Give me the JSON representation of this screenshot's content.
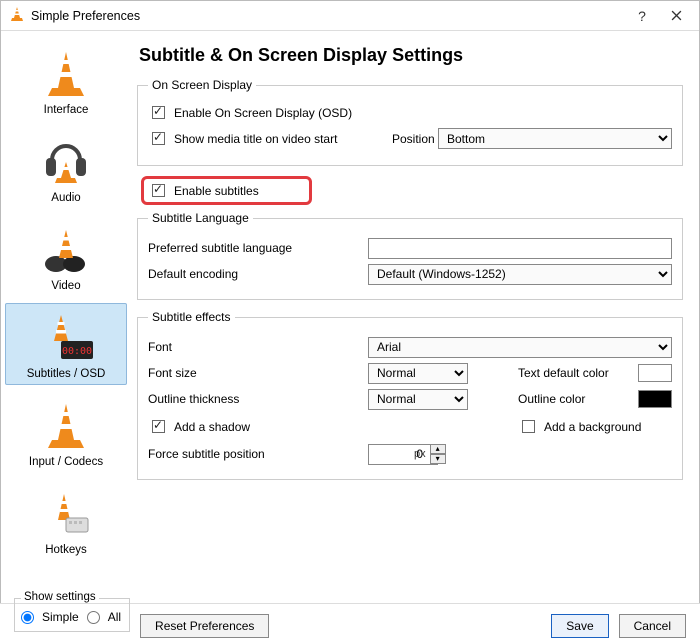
{
  "window_title": "Simple Preferences",
  "sidebar": {
    "items": [
      {
        "label": "Interface"
      },
      {
        "label": "Audio"
      },
      {
        "label": "Video"
      },
      {
        "label": "Subtitles / OSD"
      },
      {
        "label": "Input / Codecs"
      },
      {
        "label": "Hotkeys"
      }
    ],
    "selected_index": 3
  },
  "page_heading": "Subtitle & On Screen Display Settings",
  "osd_group_title": "On Screen Display",
  "osd_enable_label": "Enable On Screen Display (OSD)",
  "osd_enable_checked": true,
  "show_media_title_label": "Show media title on video start",
  "show_media_title_checked": true,
  "position_label": "Position",
  "position_value": "Bottom",
  "enable_subtitles_label": "Enable subtitles",
  "enable_subtitles_checked": true,
  "lang_group_title": "Subtitle Language",
  "preferred_lang_label": "Preferred subtitle language",
  "preferred_lang_value": "",
  "encoding_label": "Default encoding",
  "encoding_value": "Default (Windows-1252)",
  "fx_group_title": "Subtitle effects",
  "font_label": "Font",
  "font_value": "Arial",
  "font_size_label": "Font size",
  "font_size_value": "Normal",
  "text_color_label": "Text default color",
  "text_color_value": "#ffffff",
  "outline_thickness_label": "Outline thickness",
  "outline_thickness_value": "Normal",
  "outline_color_label": "Outline color",
  "outline_color_value": "#000000",
  "add_shadow_label": "Add a shadow",
  "add_shadow_checked": true,
  "add_background_label": "Add a background",
  "add_background_checked": false,
  "force_position_label": "Force subtitle position",
  "force_position_value": "0",
  "force_position_unit": "px",
  "bottom": {
    "show_settings_title": "Show settings",
    "simple_label": "Simple",
    "all_label": "All",
    "mode": "simple",
    "reset_label": "Reset Preferences",
    "save_label": "Save",
    "cancel_label": "Cancel"
  }
}
